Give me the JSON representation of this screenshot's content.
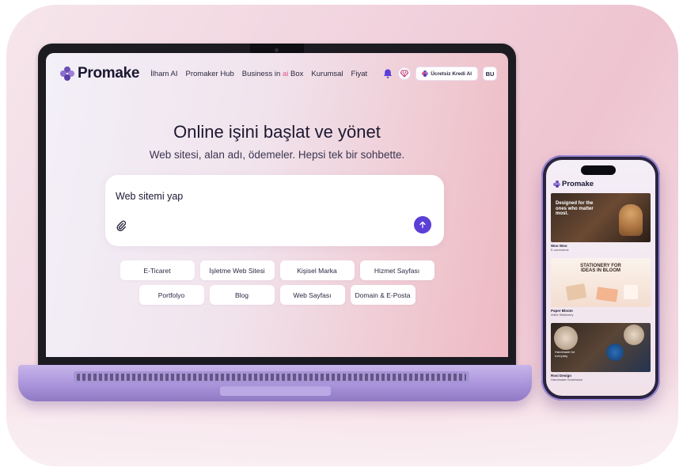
{
  "laptop": {
    "nav": {
      "brand": "Promake",
      "links": [
        "İlham AI",
        "Promaker Hub",
        "Business in",
        "ai",
        "Box",
        "Kurumsal",
        "Fiyat"
      ],
      "credit_button": "Ücretsiz Kredi Al",
      "avatar": "BU"
    },
    "hero": {
      "title": "Online işini başlat ve yönet",
      "subtitle": "Web sitesi, alan adı, ödemeler. Hepsi tek bir sohbette."
    },
    "prompt": {
      "value": "Web sitemi yap"
    },
    "chips_row1": [
      "E-Ticaret",
      "İşletme Web Sitesi",
      "Kişisel Marka",
      "Hizmet Sayfası"
    ],
    "chips_row2": [
      "Portfolyo",
      "Blog",
      "Web Sayfası",
      "Domain & E-Posta"
    ]
  },
  "phone": {
    "brand": "Promake",
    "cards": [
      {
        "title": "Woo Woo",
        "subtitle": "E-commerce",
        "headline": "Designed for the ones who matter most."
      },
      {
        "title": "Paper Bloom",
        "subtitle": "Artful Stationery",
        "headline": "STATIONERY FOR IDEAS IN BLOOM"
      },
      {
        "title": "Rosi Design",
        "subtitle": "Handmade Homeware",
        "headline": "Handmade for everyday"
      }
    ]
  },
  "colors": {
    "accent": "#5b3fd6",
    "brand_purple": "#6d4fb8",
    "ai_highlight": "#e2568a"
  }
}
